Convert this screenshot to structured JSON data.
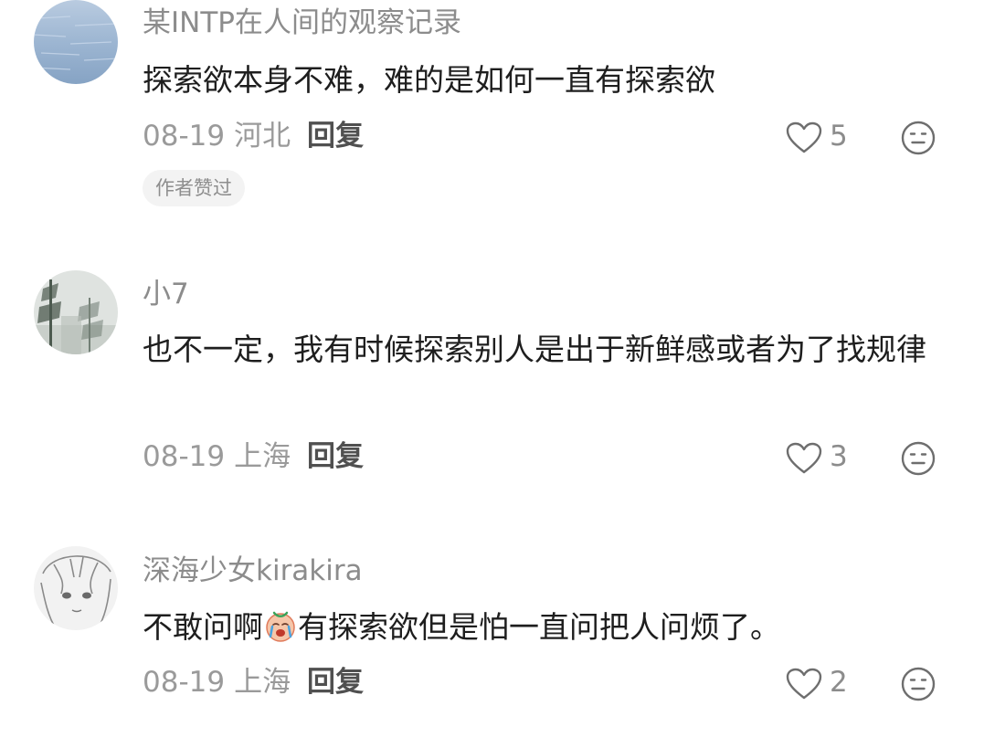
{
  "comments": [
    {
      "username": "某INTP在人间的观察记录",
      "text": "探索欲本身不难，难的是如何一直有探索欲",
      "date": "08-19",
      "location": "河北",
      "reply_label": "回复",
      "likes": "5",
      "badge": "作者赞过"
    },
    {
      "username": "小7",
      "text": "也不一定，我有时候探索别人是出于新鲜感或者为了找规律",
      "date": "08-19",
      "location": "上海",
      "reply_label": "回复",
      "likes": "3"
    },
    {
      "username": "深海少女kirakira",
      "text_before": "不敢问啊",
      "text_after": "有探索欲但是怕一直问把人问烦了。",
      "date": "08-19",
      "location": "上海",
      "reply_label": "回复",
      "likes": "2"
    }
  ],
  "icons": {
    "like": "heart-outline-icon",
    "emoji": "neutral-face-icon",
    "inline": "crying-face-emoji"
  },
  "colors": {
    "username": "#8c8c8c",
    "content": "#1e1e1e",
    "meta": "#9a9a9a",
    "badge_bg": "#f3f3f3"
  }
}
